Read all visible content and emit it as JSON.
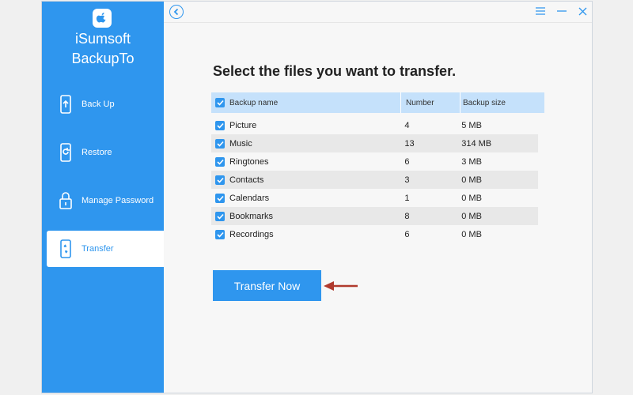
{
  "app": {
    "name_line1": "iSumsoft",
    "name_line2": "BackupTo",
    "logo_icon": "apple-icon"
  },
  "sidebar": {
    "items": [
      {
        "label": "Back Up",
        "icon": "backup-phone-icon",
        "active": false
      },
      {
        "label": "Restore",
        "icon": "restore-phone-icon",
        "active": false
      },
      {
        "label": "Manage Password",
        "icon": "lock-icon",
        "active": false
      },
      {
        "label": "Transfer",
        "icon": "transfer-phone-icon",
        "active": true
      }
    ]
  },
  "titlebar": {
    "back_icon": "chevron-left-icon",
    "menu_icon": "hamburger-icon",
    "minimize_icon": "minimize-icon",
    "close_icon": "close-icon"
  },
  "main": {
    "headline": "Select the files you want to transfer.",
    "table": {
      "headers": [
        "Backup name",
        "Number",
        "Backup size"
      ],
      "header_checked": true,
      "rows": [
        {
          "name": "Picture",
          "number": "4",
          "size": "5 MB",
          "checked": true
        },
        {
          "name": "Music",
          "number": "13",
          "size": "314 MB",
          "checked": true
        },
        {
          "name": "Ringtones",
          "number": "6",
          "size": "3 MB",
          "checked": true
        },
        {
          "name": "Contacts",
          "number": "3",
          "size": "0 MB",
          "checked": true
        },
        {
          "name": "Calendars",
          "number": "1",
          "size": "0 MB",
          "checked": true
        },
        {
          "name": "Bookmarks",
          "number": "8",
          "size": "0 MB",
          "checked": true
        },
        {
          "name": "Recordings",
          "number": "6",
          "size": "0 MB",
          "checked": true
        }
      ]
    },
    "transfer_button": "Transfer Now"
  },
  "colors": {
    "accent": "#2f96ee",
    "header_row": "#c5e1fb",
    "alt_row": "#e8e8e8",
    "annotation_arrow": "#b03a2e"
  }
}
